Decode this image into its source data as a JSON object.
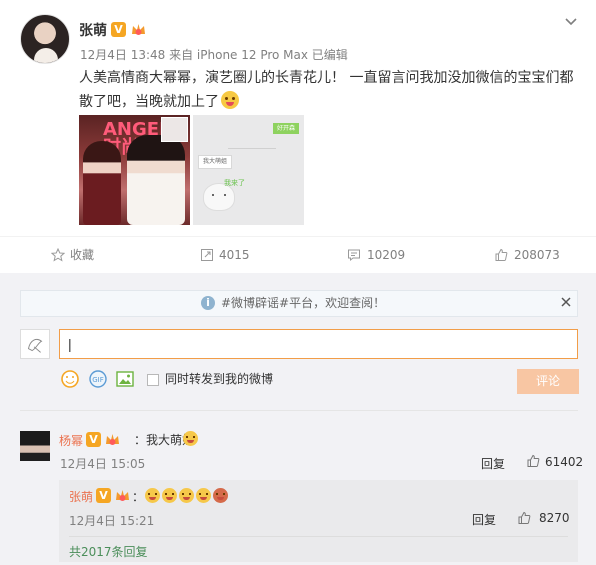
{
  "post": {
    "author": "张萌",
    "verified_badge": "V",
    "meta": "12月4日 13:48 来自 iPhone 12 Pro Max 已编辑",
    "text": "人美高情商大幂幂，演艺圈儿的长青花儿！ 一直留言问我加没加微信的宝宝们都散了吧，当晚就加上了",
    "image1_sign": "ANGEL\n时尚",
    "image2_green_label": "好开森",
    "image2_bubble": "我大萌姐",
    "image2_sticker_label": "我来了"
  },
  "actions": {
    "favorite": {
      "label": "收藏",
      "icon": "star-icon"
    },
    "repost": {
      "label": "4015",
      "icon": "repost-icon"
    },
    "comment": {
      "label": "10209",
      "icon": "comment-icon"
    },
    "like": {
      "label": "208073",
      "icon": "thumb-up-icon"
    }
  },
  "comments_panel": {
    "notice": "#微博辟谣#平台，欢迎查阅！",
    "input_value": "|",
    "forward_label": "同时转发到我的微博",
    "submit_label": "评论",
    "tools": [
      "emoji-icon",
      "gif-icon",
      "image-icon"
    ]
  },
  "comment": {
    "author": "杨幂",
    "text": "：我大萌姐",
    "time": "12月4日 15:05",
    "reply_label": "回复",
    "like_count": "61402"
  },
  "reply": {
    "author": "张萌",
    "text": "：",
    "time": "12月4日 15:21",
    "reply_label": "回复",
    "like_count": "8270",
    "total_replies": "共2017条回复"
  },
  "colors": {
    "accent_orange": "#eb7350",
    "input_border": "#f29d48",
    "badge_orange": "#f5a623",
    "green_link": "#4b8e5a"
  }
}
